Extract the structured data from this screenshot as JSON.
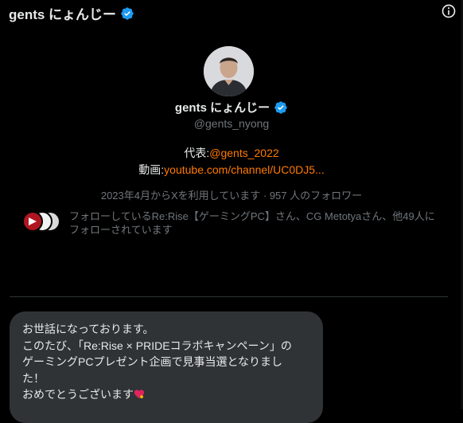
{
  "header": {
    "title": "gents にょんじー"
  },
  "profile": {
    "name": "gents にょんじー",
    "handle": "@gents_nyong",
    "bio": {
      "line1_label": "代表:",
      "line1_link": "@gents_2022",
      "line2_label": "動画:",
      "line2_link": "youtube.com/channel/UC0DJ5..."
    },
    "meta": "2023年4月からXを利用しています · 957 人のフォロワー",
    "followers_you_know": "フォローしているRe:Rise【ゲーミングPC】さん、CG Metotyaさん、他49人にフォローされています"
  },
  "message": {
    "lines": [
      "お世話になっております。",
      "このたび、「Re:Rise × PRIDEコラボキャンペーン」の",
      "ゲーミングPCプレゼント企画で見事当選となりまし",
      "た！",
      "おめでとうございます"
    ]
  },
  "colors": {
    "background": "#000000",
    "accent_link": "#ff7a00",
    "verified": "#1d9bf0",
    "muted_text": "#71767b",
    "bubble": "#2f3336"
  },
  "icons": [
    "verified-badge-icon",
    "info-icon",
    "heart-emoji-icon"
  ]
}
